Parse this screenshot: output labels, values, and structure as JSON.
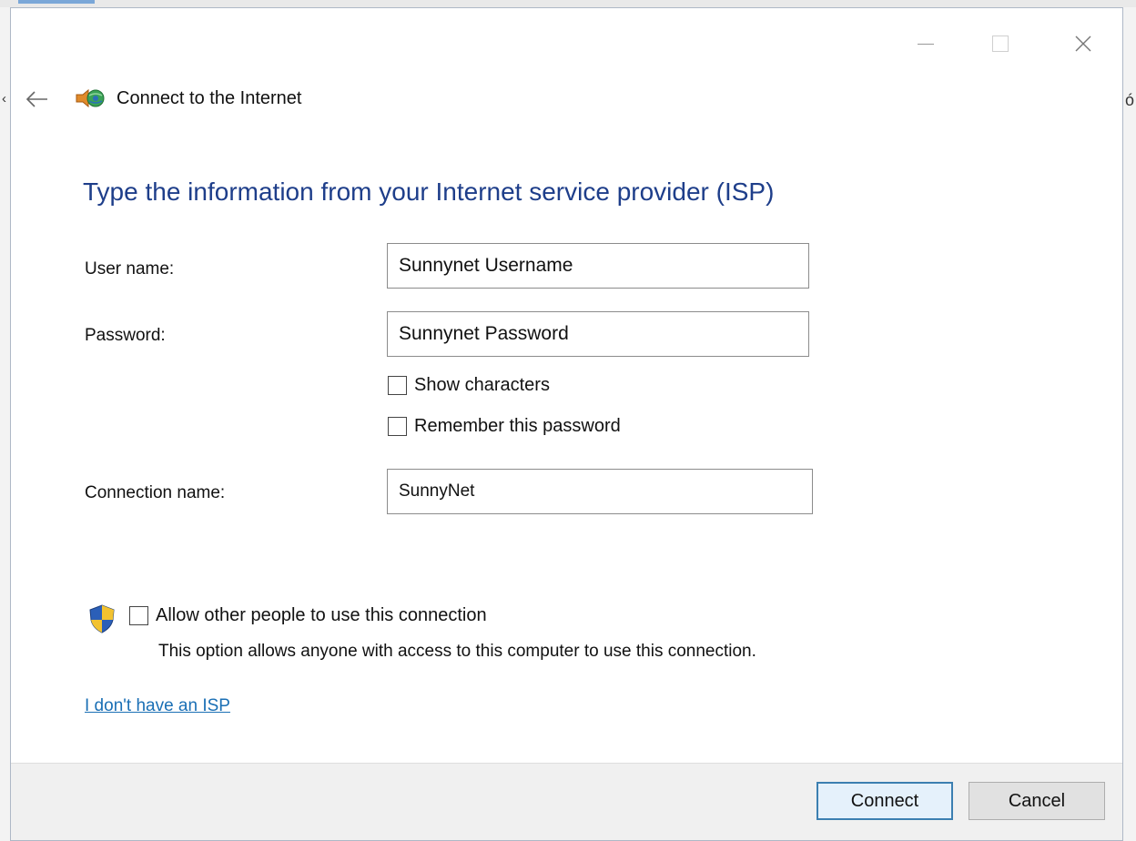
{
  "window": {
    "title": "Connect to the Internet",
    "controls": [
      "minimize-icon",
      "maximize-icon",
      "close-icon"
    ]
  },
  "heading": "Type the information from your Internet service provider (ISP)",
  "form": {
    "username_label": "User name:",
    "username_value": "Sunnynet Username",
    "password_label": "Password:",
    "password_value": "Sunnynet Password",
    "show_characters_label": "Show characters",
    "show_characters_checked": false,
    "remember_password_label": "Remember this password",
    "remember_password_checked": false,
    "connection_name_label": "Connection name:",
    "connection_name_value": "SunnyNet"
  },
  "sharing": {
    "allow_label": "Allow other people to use this connection",
    "allow_checked": false,
    "note": "This option allows anyone with access to this computer to use this connection."
  },
  "link": "I don't have an ISP",
  "buttons": {
    "connect": "Connect",
    "cancel": "Cancel"
  },
  "colors": {
    "heading": "#1e3e8a",
    "link": "#1a6fb5",
    "primary_border": "#3c7fb1"
  }
}
